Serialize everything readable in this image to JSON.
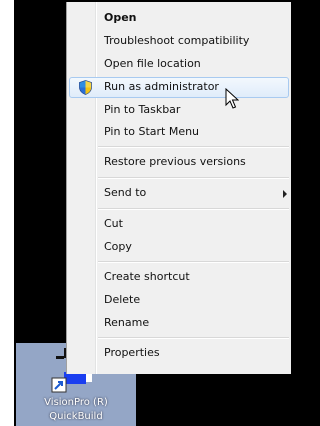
{
  "menu": {
    "items": [
      {
        "label": "Open",
        "bold": true
      },
      {
        "label": "Troubleshoot compatibility"
      },
      {
        "label": "Open file location"
      },
      {
        "label": "Run as administrator",
        "icon": "uac-shield-icon",
        "highlighted": true
      },
      {
        "label": "Pin to Taskbar"
      },
      {
        "label": "Pin to Start Menu"
      },
      {
        "label": "Restore previous versions"
      },
      {
        "label": "Send to",
        "submenu": true
      },
      {
        "label": "Cut"
      },
      {
        "label": "Copy"
      },
      {
        "label": "Create shortcut"
      },
      {
        "label": "Delete"
      },
      {
        "label": "Rename"
      },
      {
        "label": "Properties"
      }
    ]
  },
  "desktop_icon": {
    "line1": "VisionPro (R)",
    "line2": "QuickBuild",
    "icon": "visionpro-shortcut-icon",
    "selected": true
  },
  "colors": {
    "menu_background": "#f0f0f0",
    "highlight": "#e0ecfa",
    "selection": "#94a6c6"
  }
}
